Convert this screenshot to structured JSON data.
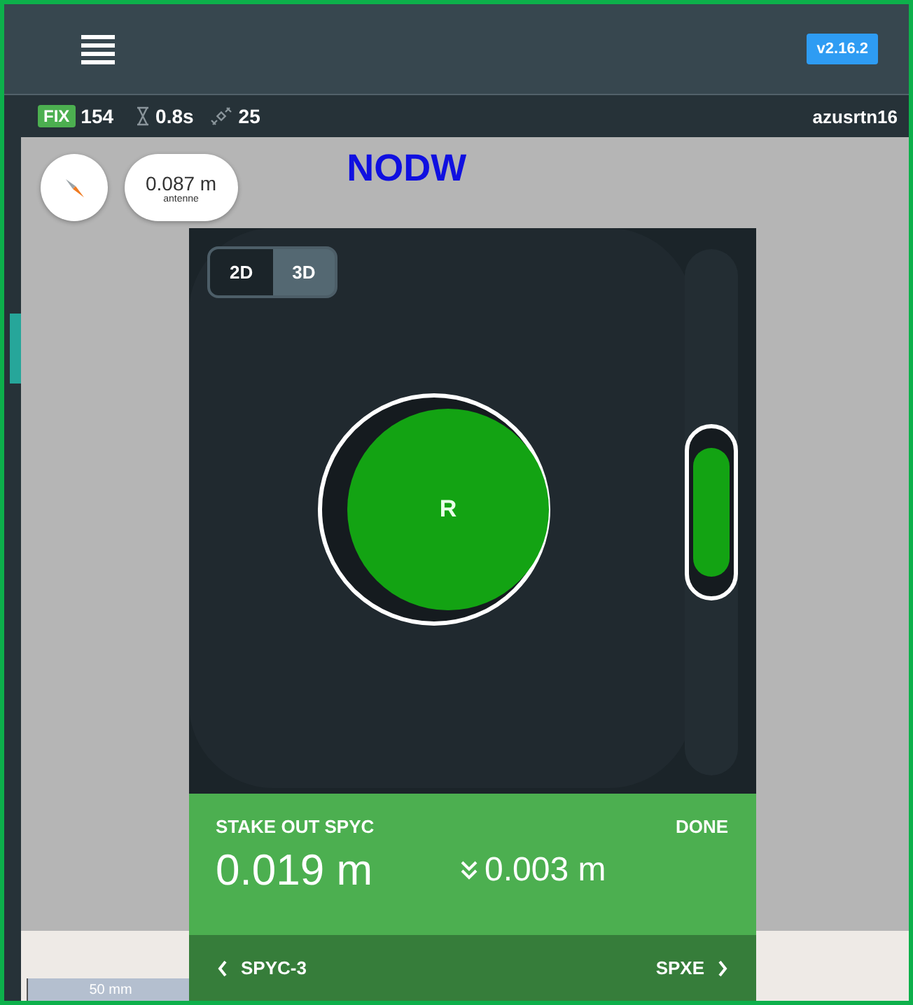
{
  "top_bar": {
    "version": "v2.16.2"
  },
  "status_bar": {
    "fix": "FIX",
    "fix_count": "154",
    "age": "0.8s",
    "satellites": "25",
    "user": "azusrtn16"
  },
  "map": {
    "antenna_height": "0.087 m",
    "antenna_label": "antenne",
    "point_name": "NODW",
    "scale": "50 mm"
  },
  "view_toggle": [
    {
      "label": "2D",
      "selected": true
    },
    {
      "label": "3D",
      "selected": false
    }
  ],
  "target": {
    "label": "R"
  },
  "height_slider": {
    "level": 0.5
  },
  "stakeout": {
    "title": "STAKE OUT SPYC",
    "done": "DONE",
    "distance": "0.019 m",
    "height": "0.003 m",
    "previous": "SPYC-3",
    "next": "SPXE"
  }
}
